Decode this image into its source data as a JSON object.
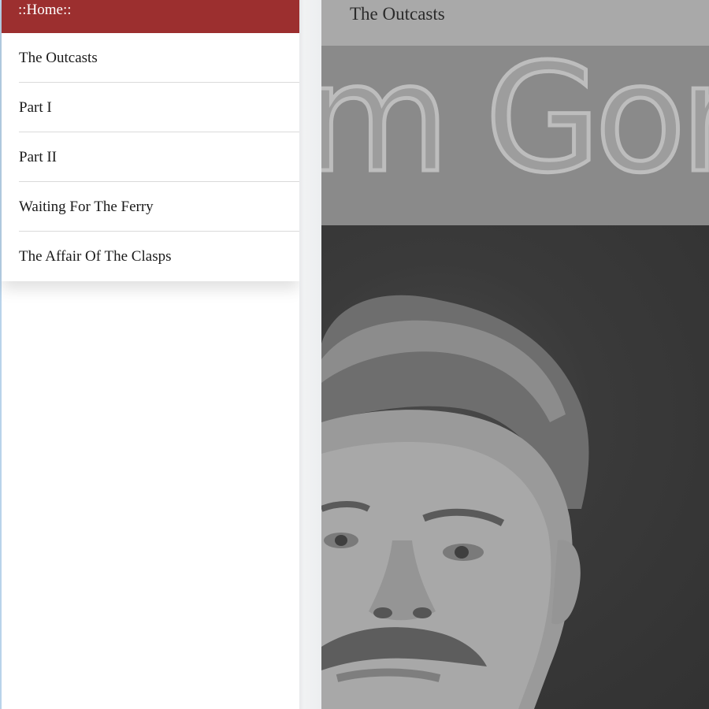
{
  "menu": {
    "home_label": "::Home::",
    "items": [
      {
        "label": "The Outcasts"
      },
      {
        "label": "Part I"
      },
      {
        "label": "Part II"
      },
      {
        "label": "Waiting For The Ferry"
      },
      {
        "label": "The Affair Of The Clasps"
      }
    ]
  },
  "header": {
    "title": "The Outcasts"
  },
  "cover": {
    "banner_text": "m Gorky",
    "portrait": "author-portrait"
  },
  "colors": {
    "menu_header_bg": "#9c2f2f",
    "topbar_bg": "#a9a9a9"
  }
}
